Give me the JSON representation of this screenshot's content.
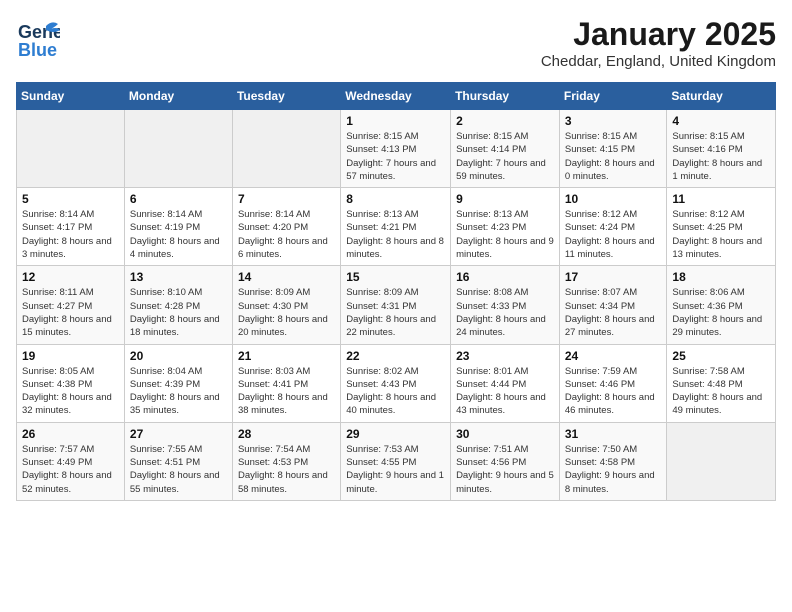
{
  "header": {
    "logo_general": "General",
    "logo_blue": "Blue",
    "month": "January 2025",
    "location": "Cheddar, England, United Kingdom"
  },
  "weekdays": [
    "Sunday",
    "Monday",
    "Tuesday",
    "Wednesday",
    "Thursday",
    "Friday",
    "Saturday"
  ],
  "weeks": [
    [
      {
        "day": "",
        "info": ""
      },
      {
        "day": "",
        "info": ""
      },
      {
        "day": "",
        "info": ""
      },
      {
        "day": "1",
        "info": "Sunrise: 8:15 AM\nSunset: 4:13 PM\nDaylight: 7 hours and 57 minutes."
      },
      {
        "day": "2",
        "info": "Sunrise: 8:15 AM\nSunset: 4:14 PM\nDaylight: 7 hours and 59 minutes."
      },
      {
        "day": "3",
        "info": "Sunrise: 8:15 AM\nSunset: 4:15 PM\nDaylight: 8 hours and 0 minutes."
      },
      {
        "day": "4",
        "info": "Sunrise: 8:15 AM\nSunset: 4:16 PM\nDaylight: 8 hours and 1 minute."
      }
    ],
    [
      {
        "day": "5",
        "info": "Sunrise: 8:14 AM\nSunset: 4:17 PM\nDaylight: 8 hours and 3 minutes."
      },
      {
        "day": "6",
        "info": "Sunrise: 8:14 AM\nSunset: 4:19 PM\nDaylight: 8 hours and 4 minutes."
      },
      {
        "day": "7",
        "info": "Sunrise: 8:14 AM\nSunset: 4:20 PM\nDaylight: 8 hours and 6 minutes."
      },
      {
        "day": "8",
        "info": "Sunrise: 8:13 AM\nSunset: 4:21 PM\nDaylight: 8 hours and 8 minutes."
      },
      {
        "day": "9",
        "info": "Sunrise: 8:13 AM\nSunset: 4:23 PM\nDaylight: 8 hours and 9 minutes."
      },
      {
        "day": "10",
        "info": "Sunrise: 8:12 AM\nSunset: 4:24 PM\nDaylight: 8 hours and 11 minutes."
      },
      {
        "day": "11",
        "info": "Sunrise: 8:12 AM\nSunset: 4:25 PM\nDaylight: 8 hours and 13 minutes."
      }
    ],
    [
      {
        "day": "12",
        "info": "Sunrise: 8:11 AM\nSunset: 4:27 PM\nDaylight: 8 hours and 15 minutes."
      },
      {
        "day": "13",
        "info": "Sunrise: 8:10 AM\nSunset: 4:28 PM\nDaylight: 8 hours and 18 minutes."
      },
      {
        "day": "14",
        "info": "Sunrise: 8:09 AM\nSunset: 4:30 PM\nDaylight: 8 hours and 20 minutes."
      },
      {
        "day": "15",
        "info": "Sunrise: 8:09 AM\nSunset: 4:31 PM\nDaylight: 8 hours and 22 minutes."
      },
      {
        "day": "16",
        "info": "Sunrise: 8:08 AM\nSunset: 4:33 PM\nDaylight: 8 hours and 24 minutes."
      },
      {
        "day": "17",
        "info": "Sunrise: 8:07 AM\nSunset: 4:34 PM\nDaylight: 8 hours and 27 minutes."
      },
      {
        "day": "18",
        "info": "Sunrise: 8:06 AM\nSunset: 4:36 PM\nDaylight: 8 hours and 29 minutes."
      }
    ],
    [
      {
        "day": "19",
        "info": "Sunrise: 8:05 AM\nSunset: 4:38 PM\nDaylight: 8 hours and 32 minutes."
      },
      {
        "day": "20",
        "info": "Sunrise: 8:04 AM\nSunset: 4:39 PM\nDaylight: 8 hours and 35 minutes."
      },
      {
        "day": "21",
        "info": "Sunrise: 8:03 AM\nSunset: 4:41 PM\nDaylight: 8 hours and 38 minutes."
      },
      {
        "day": "22",
        "info": "Sunrise: 8:02 AM\nSunset: 4:43 PM\nDaylight: 8 hours and 40 minutes."
      },
      {
        "day": "23",
        "info": "Sunrise: 8:01 AM\nSunset: 4:44 PM\nDaylight: 8 hours and 43 minutes."
      },
      {
        "day": "24",
        "info": "Sunrise: 7:59 AM\nSunset: 4:46 PM\nDaylight: 8 hours and 46 minutes."
      },
      {
        "day": "25",
        "info": "Sunrise: 7:58 AM\nSunset: 4:48 PM\nDaylight: 8 hours and 49 minutes."
      }
    ],
    [
      {
        "day": "26",
        "info": "Sunrise: 7:57 AM\nSunset: 4:49 PM\nDaylight: 8 hours and 52 minutes."
      },
      {
        "day": "27",
        "info": "Sunrise: 7:55 AM\nSunset: 4:51 PM\nDaylight: 8 hours and 55 minutes."
      },
      {
        "day": "28",
        "info": "Sunrise: 7:54 AM\nSunset: 4:53 PM\nDaylight: 8 hours and 58 minutes."
      },
      {
        "day": "29",
        "info": "Sunrise: 7:53 AM\nSunset: 4:55 PM\nDaylight: 9 hours and 1 minute."
      },
      {
        "day": "30",
        "info": "Sunrise: 7:51 AM\nSunset: 4:56 PM\nDaylight: 9 hours and 5 minutes."
      },
      {
        "day": "31",
        "info": "Sunrise: 7:50 AM\nSunset: 4:58 PM\nDaylight: 9 hours and 8 minutes."
      },
      {
        "day": "",
        "info": ""
      }
    ]
  ]
}
